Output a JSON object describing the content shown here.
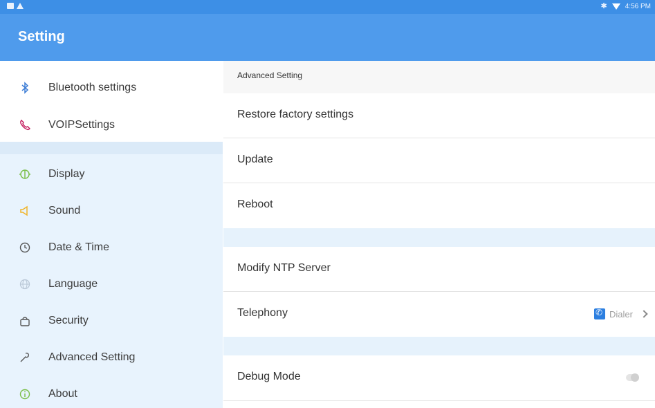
{
  "status_bar": {
    "left_icons": [
      "notification-icon",
      "warning-icon"
    ],
    "right_icons": [
      "bluetooth-icon",
      "wifi-icon"
    ],
    "time": "4:56 PM"
  },
  "app_bar": {
    "title": "Setting"
  },
  "sidebar": {
    "items": [
      {
        "label": "Bluetooth settings",
        "icon": "bluetooth-icon",
        "color": "#3a7bd5"
      },
      {
        "label": "VOIPSettings",
        "icon": "phone-icon",
        "color": "#c2185b"
      },
      {
        "label": "Display",
        "icon": "display-icon",
        "color": "#7cbf4a"
      },
      {
        "label": "Sound",
        "icon": "speaker-icon",
        "color": "#f0b429"
      },
      {
        "label": "Date & Time",
        "icon": "clock-icon",
        "color": "#555555"
      },
      {
        "label": "Language",
        "icon": "globe-icon",
        "color": "#b9c7d6"
      },
      {
        "label": "Security",
        "icon": "lock-icon",
        "color": "#555555"
      },
      {
        "label": "Advanced Setting",
        "icon": "wrench-icon",
        "color": "#555555"
      },
      {
        "label": "About",
        "icon": "info-icon",
        "color": "#7cbf4a"
      }
    ]
  },
  "main": {
    "section_title": "Advanced Setting",
    "rows": [
      {
        "label": "Restore factory settings"
      },
      {
        "label": "Update"
      },
      {
        "label": "Reboot"
      },
      {
        "label": "Modify NTP Server"
      },
      {
        "label": "Telephony",
        "value": "Dialer"
      },
      {
        "label": "Debug Mode",
        "toggle_on": false
      }
    ]
  },
  "colors": {
    "status_bar": "#3d8fe6",
    "app_bar": "#4f9bec",
    "sidebar_bg": "#e8f3fd",
    "spacer_bg": "#e6f2fc"
  }
}
